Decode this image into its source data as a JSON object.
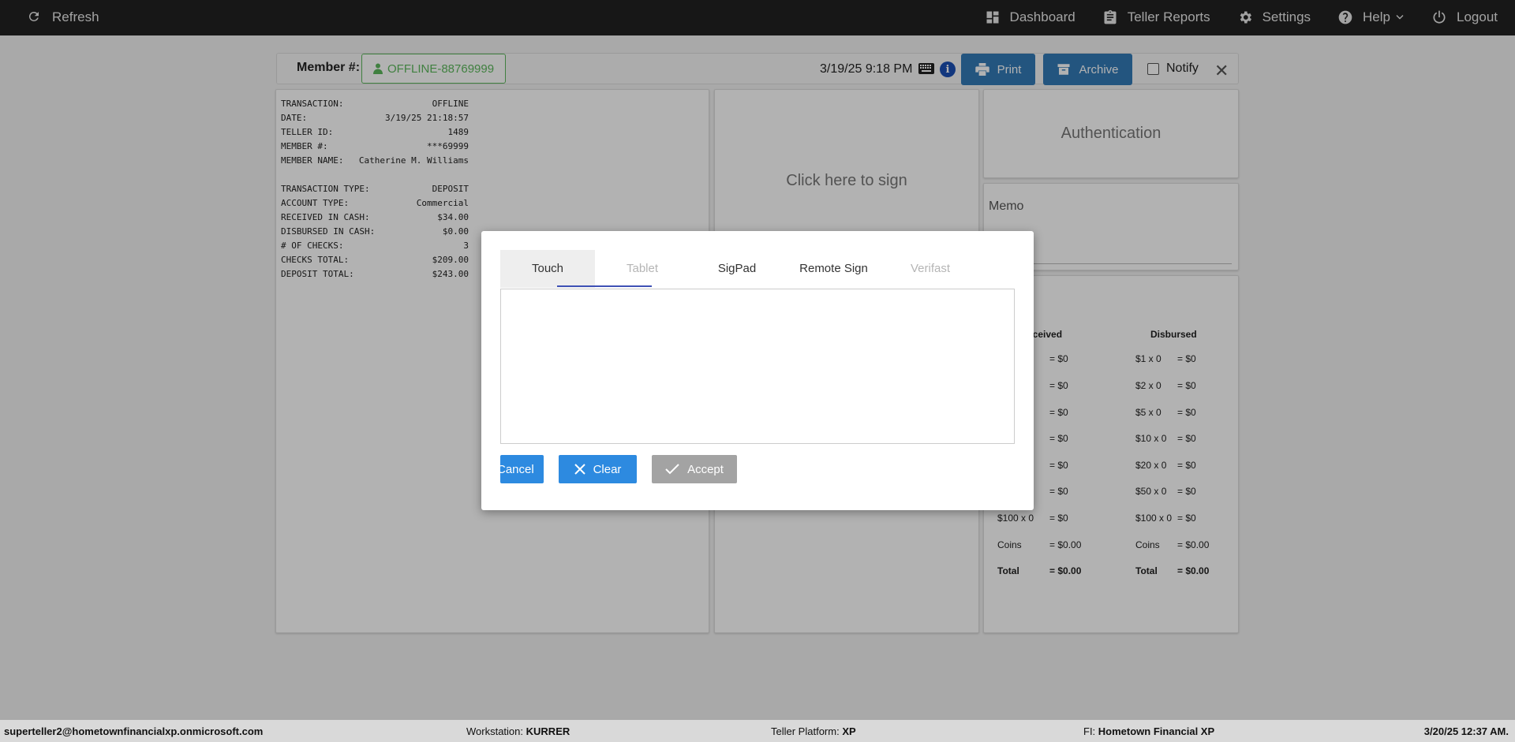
{
  "navbar": {
    "refresh_label": "Refresh",
    "dashboard_label": "Dashboard",
    "teller_reports_label": "Teller Reports",
    "settings_label": "Settings",
    "help_label": "Help",
    "logout_label": "Logout"
  },
  "header": {
    "member_label": "Member #:",
    "member_value": "OFFLINE-88769999",
    "datetime": "3/19/25 9:18 PM",
    "info_glyph": "i",
    "print_label": "Print",
    "archive_label": "Archive",
    "notify_label": "Notify"
  },
  "receipt": {
    "rows": [
      {
        "k": "TRANSACTION:",
        "v": "OFFLINE"
      },
      {
        "k": "DATE:",
        "v": "3/19/25 21:18:57"
      },
      {
        "k": "TELLER ID:",
        "v": "1489"
      },
      {
        "k": "MEMBER #:",
        "v": "***69999"
      },
      {
        "k": "MEMBER NAME:",
        "v": "Catherine M. Williams"
      },
      {
        "k": "TRANSACTION TYPE:",
        "v": "DEPOSIT"
      },
      {
        "k": "ACCOUNT TYPE:",
        "v": "Commercial"
      },
      {
        "k": "RECEIVED IN CASH:",
        "v": "$34.00"
      },
      {
        "k": "DISBURSED IN CASH:",
        "v": "$0.00"
      },
      {
        "k": "# OF CHECKS:",
        "v": "3"
      },
      {
        "k": "CHECKS TOTAL:",
        "v": "$209.00"
      },
      {
        "k": "DEPOSIT TOTAL:",
        "v": "$243.00"
      }
    ]
  },
  "sign_panel": {
    "text": "Click here to sign"
  },
  "auth_panel": {
    "text": "Authentication"
  },
  "memo_panel": {
    "label": "Memo"
  },
  "cash": {
    "received_header": "eceived",
    "disbursed_header": "Disbursed",
    "rows": [
      {
        "r_label": "",
        "r_val": "= $0",
        "d_label": "$1 x 0",
        "d_val": "= $0"
      },
      {
        "r_label": "",
        "r_val": "= $0",
        "d_label": "$2 x 0",
        "d_val": "= $0"
      },
      {
        "r_label": "",
        "r_val": "= $0",
        "d_label": "$5 x 0",
        "d_val": "= $0"
      },
      {
        "r_label": "",
        "r_val": "= $0",
        "d_label": "$10 x 0",
        "d_val": "= $0"
      },
      {
        "r_label": "",
        "r_val": "= $0",
        "d_label": "$20 x 0",
        "d_val": "= $0"
      },
      {
        "r_label": "",
        "r_val": "= $0",
        "d_label": "$50 x 0",
        "d_val": "= $0"
      },
      {
        "r_label": "$100 x 0",
        "r_val": "= $0",
        "d_label": "$100 x 0",
        "d_val": "= $0"
      },
      {
        "r_label": "Coins",
        "r_val": "= $0.00",
        "d_label": "Coins",
        "d_val": "= $0.00"
      },
      {
        "r_label": "Total",
        "r_val": "= $0.00",
        "d_label": "Total",
        "d_val": "= $0.00"
      }
    ]
  },
  "modal": {
    "tabs": [
      {
        "label": "Touch",
        "state": "active"
      },
      {
        "label": "Tablet",
        "state": "disabled"
      },
      {
        "label": "SigPad",
        "state": "normal"
      },
      {
        "label": "Remote Sign",
        "state": "normal"
      },
      {
        "label": "Verifast",
        "state": "disabled"
      }
    ],
    "cancel_label": "Cancel",
    "clear_label": "Clear",
    "accept_label": "Accept"
  },
  "footer": {
    "user": "superteller2@hometownfinancialxp.onmicrosoft.com",
    "workstation_label": "Workstation:",
    "workstation_value": "KURRER",
    "platform_label": "Teller Platform:",
    "platform_value": "XP",
    "fi_label": "FI:",
    "fi_value": "Hometown Financial XP",
    "datetime": "3/20/25 12:37 AM."
  },
  "colors": {
    "navbar_bg": "#222222",
    "primary_button": "#2d8ae0",
    "member_green": "#5cb85c",
    "tab_underline": "#3f51b5",
    "accept_disabled": "#a3a3a3"
  },
  "icons": {
    "refresh": "refresh-icon",
    "dashboard": "dashboard-icon",
    "teller_reports": "clipboard-icon",
    "settings": "gear-icon",
    "help": "question-circle-icon",
    "logout": "power-icon",
    "member": "user-icon",
    "keyboard": "keyboard-icon",
    "info": "info-icon",
    "print": "printer-icon",
    "archive": "archive-icon",
    "close": "close-icon",
    "clear": "x-icon",
    "accept": "checkmark-icon"
  }
}
